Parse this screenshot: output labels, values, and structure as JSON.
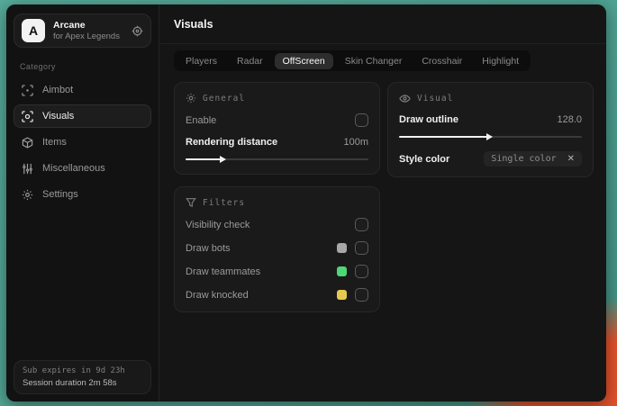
{
  "app": {
    "logo_letter": "A",
    "name": "Arcane",
    "subtitle": "for Apex Legends"
  },
  "sidebar": {
    "category_label": "Category",
    "items": [
      {
        "label": "Aimbot"
      },
      {
        "label": "Visuals"
      },
      {
        "label": "Items"
      },
      {
        "label": "Miscellaneous"
      },
      {
        "label": "Settings"
      }
    ],
    "footer": {
      "sub_expires": "Sub expires in 9d 23h",
      "session_duration": "Session duration 2m 58s"
    }
  },
  "main": {
    "title": "Visuals",
    "tabs": [
      {
        "label": "Players"
      },
      {
        "label": "Radar"
      },
      {
        "label": "OffScreen",
        "active": true
      },
      {
        "label": "Skin Changer"
      },
      {
        "label": "Crosshair"
      },
      {
        "label": "Highlight"
      }
    ],
    "general": {
      "title": "General",
      "enable_label": "Enable",
      "rendering_distance_label": "Rendering distance",
      "rendering_distance_value": "100m",
      "rendering_distance_pct": "21%"
    },
    "filters": {
      "title": "Filters",
      "rows": [
        {
          "label": "Visibility check"
        },
        {
          "label": "Draw bots",
          "swatch": "#a8a8a8"
        },
        {
          "label": "Draw teammates",
          "swatch": "#4fd676"
        },
        {
          "label": "Draw knocked",
          "swatch": "#e6c94f"
        }
      ]
    },
    "visual": {
      "title": "Visual",
      "draw_outline_label": "Draw outline",
      "draw_outline_value": "128.0",
      "draw_outline_pct": "50%",
      "style_color_label": "Style color",
      "style_color_value": "Single color",
      "close_glyph": "✕"
    }
  },
  "colors": {
    "desktop_teal": "#4fa292",
    "desktop_orange": "#e2512b",
    "swatch_gray": "#a8a8a8",
    "swatch_green": "#4fd676",
    "swatch_yellow": "#e6c94f",
    "slider_fill": "#f2f2f2"
  }
}
